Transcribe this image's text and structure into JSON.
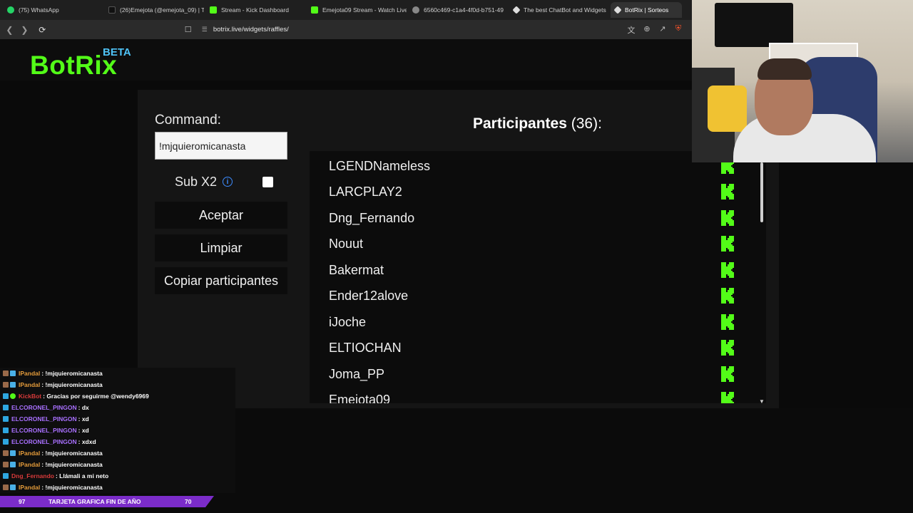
{
  "browser": {
    "tabs": [
      {
        "label": "(75) WhatsApp",
        "icon_color": "#25d366",
        "icon": "whatsapp-icon"
      },
      {
        "label": "(26)Emejota (@emejota_09) | T",
        "icon_color": "#111111",
        "icon": "tiktok-icon"
      },
      {
        "label": "Stream - Kick Dashboard",
        "icon_color": "#53fc18",
        "icon": "kick-icon"
      },
      {
        "label": "Emejota09 Stream - Watch Live",
        "icon_color": "#53fc18",
        "icon": "kick-icon"
      },
      {
        "label": "6560c469-c1a4-4f0d-b751-49",
        "icon_color": "#888888",
        "icon": "globe-icon"
      },
      {
        "label": "The best ChatBot and Widgets",
        "icon_color": "#dddddd",
        "icon": "botrix-icon"
      },
      {
        "label": "BotRix | Sorteos",
        "icon_color": "#dddddd",
        "icon": "botrix-icon"
      }
    ],
    "url": "botrix.live/widgets/raffles/"
  },
  "header": {
    "logo": "BotRix",
    "beta": "BETA"
  },
  "form": {
    "command_label": "Command:",
    "command_value": "!mjquieromicanasta",
    "sub_label": "Sub X2",
    "accept_button": "Aceptar",
    "clear_button": "Limpiar",
    "copy_button": "Copiar participantes"
  },
  "participants": {
    "title": "Participantes",
    "count": "(36):",
    "items": [
      "LGENDNameless",
      "LARCPLAY2",
      "Dng_Fernando",
      "Nouut",
      "Bakermat",
      "Ender12alove",
      "iJoche",
      "ELTIOCHAN",
      "Joma_PP",
      "Emejota09"
    ]
  },
  "chat": {
    "messages": [
      {
        "user": "IPandal",
        "color": "#e39b3a",
        "text": ": !mjquieromicanasta"
      },
      {
        "user": "IPandal",
        "color": "#e39b3a",
        "text": ": !mjquieromicanasta"
      },
      {
        "user": "KickBot",
        "color": "#d83a3a",
        "text": ": Gracias por seguirme @wendy6969"
      },
      {
        "user": "ELCORONEL_PINGON",
        "color": "#a970ff",
        "text": ": dx"
      },
      {
        "user": "ELCORONEL_PINGON",
        "color": "#a970ff",
        "text": ": xd"
      },
      {
        "user": "ELCORONEL_PINGON",
        "color": "#a970ff",
        "text": ": xd"
      },
      {
        "user": "ELCORONEL_PINGON",
        "color": "#a970ff",
        "text": ": xdxd"
      },
      {
        "user": "IPandal",
        "color": "#e39b3a",
        "text": ": !mjquieromicanasta"
      },
      {
        "user": "IPandal",
        "color": "#e39b3a",
        "text": ": !mjquieromicanasta"
      },
      {
        "user": "Dng_Fernando",
        "color": "#d83a3a",
        "text": ": Llámali a mi neto"
      },
      {
        "user": "IPandal",
        "color": "#e39b3a",
        "text": ": !mjquieromicanasta"
      }
    ]
  },
  "ticker": {
    "left_value": "97",
    "text": "TARJETA GRAFICA FIN DE AÑO",
    "right_value": "70"
  },
  "colors": {
    "kick_green": "#53fc18",
    "beta_blue": "#4fc3f7",
    "ticker_purple": "#7b2cc9"
  }
}
